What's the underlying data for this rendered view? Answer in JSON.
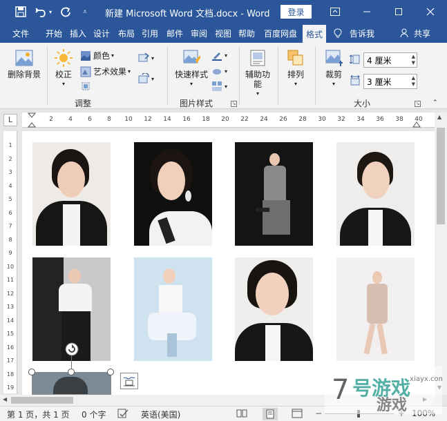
{
  "titlebar": {
    "title": "新建 Microsoft Word 文档.docx  -  Word",
    "login": "登录",
    "save_icon": "save-icon",
    "undo_icon": "undo-icon",
    "redo_icon": "redo-icon",
    "customize_icon": "customize-qat-icon",
    "window_controls": [
      "ribbon-display-icon",
      "minimize-icon",
      "maximize-icon",
      "close-icon"
    ]
  },
  "tabs": [
    "文件",
    "开始",
    "插入",
    "设计",
    "布局",
    "引用",
    "邮件",
    "审阅",
    "视图",
    "帮助",
    "百度网盘",
    "格式"
  ],
  "active_tab": "格式",
  "tell_me": "告诉我",
  "share": "共享",
  "ribbon": {
    "remove_bg": "删除背景",
    "correct": "校正",
    "color": "颜色",
    "artistic": "艺术效果",
    "adjust_group": "调整",
    "quick_styles": "快速样式",
    "picture_styles_group": "图片样式",
    "alt_text": "辅助功能",
    "arrange": "排列",
    "crop": "裁剪",
    "height": "4 厘米",
    "width": "3 厘米",
    "size_group": "大小"
  },
  "ruler": {
    "h_ticks": [
      "2",
      "4",
      "6",
      "8",
      "10",
      "12",
      "14",
      "16",
      "18",
      "20",
      "22",
      "24",
      "26",
      "28",
      "30",
      "32",
      "34",
      "36",
      "38",
      "40"
    ],
    "v_ticks": [
      "1",
      "2",
      "3",
      "4",
      "5",
      "6",
      "7",
      "8",
      "9",
      "10",
      "11",
      "12",
      "13",
      "14",
      "15",
      "16",
      "17",
      "18",
      "19"
    ],
    "corner": "L"
  },
  "status": {
    "page": "第 1 页，共 1 页",
    "words": "0 个字",
    "language": "英语(美国)",
    "zoom": "100%"
  },
  "colors": {
    "accent": "#2b579a",
    "ribbon_bg": "#f3f3f3"
  }
}
